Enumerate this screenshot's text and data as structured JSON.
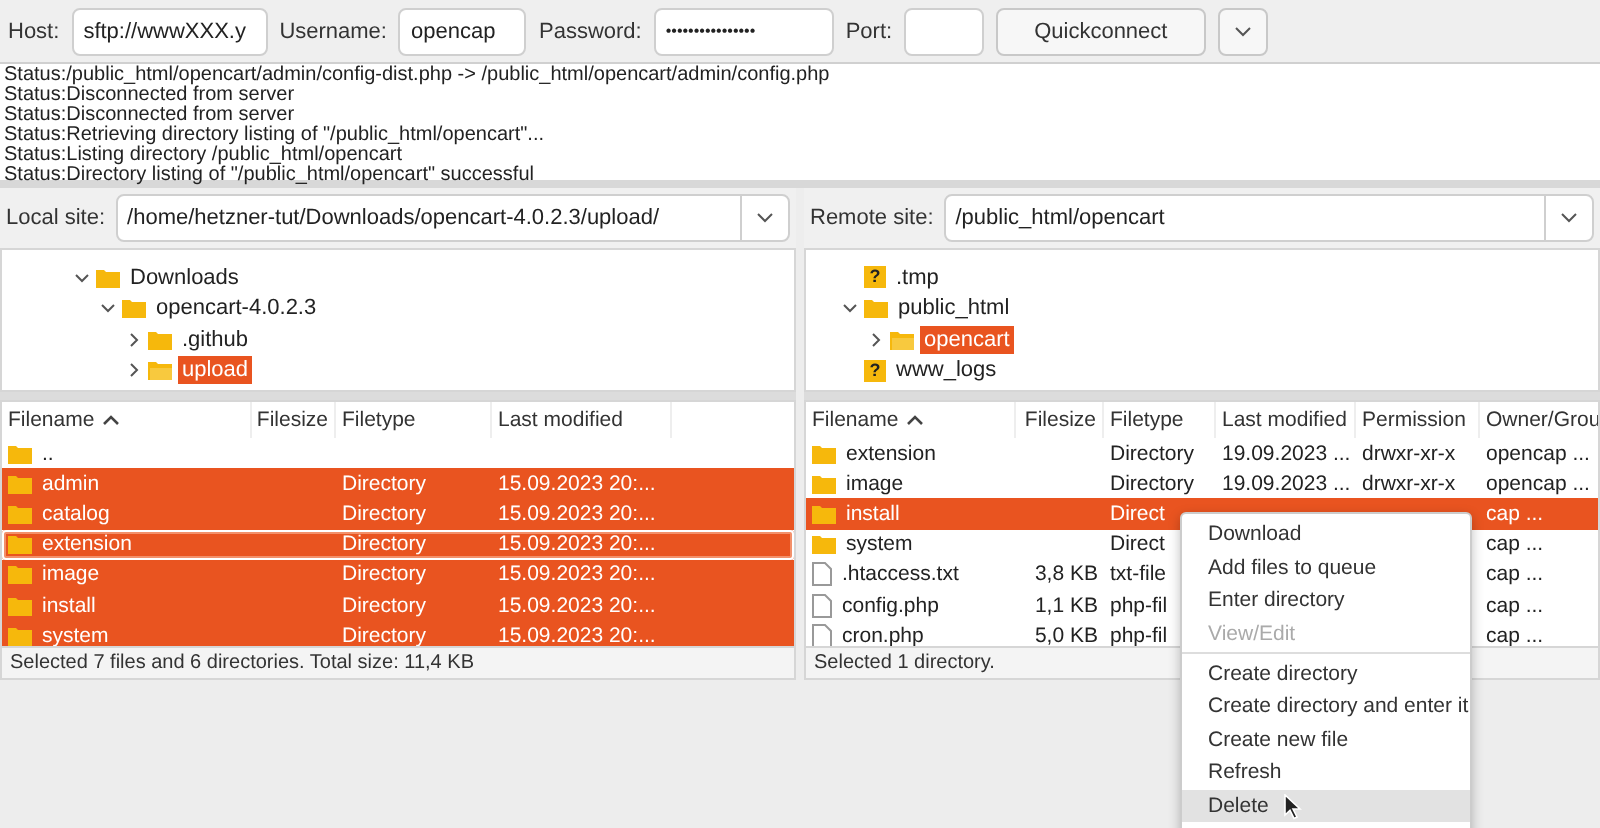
{
  "quickconnect": {
    "host_label": "Host:",
    "host": "sftp://wwwXXX.y",
    "username_label": "Username:",
    "username": "opencap",
    "password_label": "Password:",
    "password": "••••••••••••••••",
    "port_label": "Port:",
    "connect_button": "Quickconnect"
  },
  "log": [
    "Status:/public_html/opencart/admin/config-dist.php -> /public_html/opencart/admin/config.php",
    "Status:Disconnected from server",
    "Status:Disconnected from server",
    "Status:Retrieving directory listing of \"/public_html/opencart\"...",
    "Status:Listing directory /public_html/opencart",
    "Status:Directory listing of \"/public_html/opencart\" successful"
  ],
  "local": {
    "site_label": "Local site:",
    "path": "/home/hetzner-tut/Downloads/opencart-4.0.2.3/upload/",
    "tree": [
      {
        "label": "Downloads",
        "kind": "folder",
        "expanded": true,
        "selected": false,
        "children": [
          {
            "label": "opencart-4.0.2.3",
            "kind": "folder",
            "expanded": true,
            "selected": false,
            "children": [
              {
                "label": ".github",
                "kind": "folder",
                "expanded": false,
                "selected": false
              },
              {
                "label": "upload",
                "kind": "folder",
                "expanded": false,
                "selected": true
              }
            ]
          }
        ]
      }
    ],
    "columns": [
      "Filename",
      "Filesize",
      "Filetype",
      "Last modified"
    ],
    "rows": [
      {
        "name": "..",
        "kind": "folder",
        "size": "",
        "type": "",
        "modified": "",
        "selected": false,
        "focused": false
      },
      {
        "name": "admin",
        "kind": "folder",
        "size": "",
        "type": "Directory",
        "modified": "15.09.2023 20:...",
        "selected": true,
        "focused": false
      },
      {
        "name": "catalog",
        "kind": "folder",
        "size": "",
        "type": "Directory",
        "modified": "15.09.2023 20:...",
        "selected": true,
        "focused": false
      },
      {
        "name": "extension",
        "kind": "folder",
        "size": "",
        "type": "Directory",
        "modified": "15.09.2023 20:...",
        "selected": true,
        "focused": true
      },
      {
        "name": "image",
        "kind": "folder",
        "size": "",
        "type": "Directory",
        "modified": "15.09.2023 20:...",
        "selected": true,
        "focused": false
      },
      {
        "name": "install",
        "kind": "folder",
        "size": "",
        "type": "Directory",
        "modified": "15.09.2023 20:...",
        "selected": true,
        "focused": false
      },
      {
        "name": "system",
        "kind": "folder",
        "size": "",
        "type": "Directory",
        "modified": "15.09.2023 20:...",
        "selected": true,
        "focused": false
      }
    ],
    "status": "Selected 7 files and 6 directories. Total size: 11,4 KB"
  },
  "remote": {
    "site_label": "Remote site:",
    "path": "/public_html/opencart",
    "tree": [
      {
        "label": ".tmp",
        "kind": "unknown",
        "icon": "?",
        "selected": false
      },
      {
        "label": "public_html",
        "kind": "folder",
        "expanded": true,
        "selected": false,
        "children": [
          {
            "label": "opencart",
            "kind": "folder",
            "expanded": false,
            "selected": true
          }
        ]
      },
      {
        "label": "www_logs",
        "kind": "unknown",
        "icon": "?",
        "selected": false
      }
    ],
    "columns": [
      "Filename",
      "Filesize",
      "Filetype",
      "Last modified",
      "Permission",
      "Owner/Grou"
    ],
    "rows": [
      {
        "name": "extension",
        "kind": "folder",
        "size": "",
        "type": "Directory",
        "modified": "19.09.2023 ...",
        "permission": "drwxr-xr-x",
        "owner": "opencap ...",
        "selected": false
      },
      {
        "name": "image",
        "kind": "folder",
        "size": "",
        "type": "Directory",
        "modified": "19.09.2023 ...",
        "permission": "drwxr-xr-x",
        "owner": "opencap ...",
        "selected": false
      },
      {
        "name": "install",
        "kind": "folder",
        "size": "",
        "type": "Direct",
        "modified": "",
        "permission": "",
        "owner": "cap ...",
        "selected": true
      },
      {
        "name": "system",
        "kind": "folder",
        "size": "",
        "type": "Direct",
        "modified": "",
        "permission": "",
        "owner": "cap ...",
        "selected": false
      },
      {
        "name": ".htaccess.txt",
        "kind": "file",
        "size": "3,8 KB",
        "type": "txt-file",
        "modified": "",
        "permission": "",
        "owner": "cap ...",
        "selected": false
      },
      {
        "name": "config.php",
        "kind": "file",
        "size": "1,1 KB",
        "type": "php-fil",
        "modified": "",
        "permission": "",
        "owner": "cap ...",
        "selected": false
      },
      {
        "name": "cron.php",
        "kind": "file",
        "size": "5,0 KB",
        "type": "php-fil",
        "modified": "",
        "permission": "",
        "owner": "cap ...",
        "selected": false
      }
    ],
    "status": "Selected 1 directory."
  },
  "context_menu": [
    {
      "kind": "item",
      "label": "Download",
      "disabled": false,
      "hovered": false
    },
    {
      "kind": "item",
      "label": "Add files to queue",
      "disabled": false,
      "hovered": false
    },
    {
      "kind": "item",
      "label": "Enter directory",
      "disabled": false,
      "hovered": false
    },
    {
      "kind": "item",
      "label": "View/Edit",
      "disabled": true,
      "hovered": false
    },
    {
      "kind": "separator"
    },
    {
      "kind": "item",
      "label": "Create directory",
      "disabled": false,
      "hovered": false
    },
    {
      "kind": "item",
      "label": "Create directory and enter it",
      "disabled": false,
      "hovered": false
    },
    {
      "kind": "item",
      "label": "Create new file",
      "disabled": false,
      "hovered": false
    },
    {
      "kind": "item",
      "label": "Refresh",
      "disabled": false,
      "hovered": false
    },
    {
      "kind": "item",
      "label": "Delete",
      "disabled": false,
      "hovered": true
    }
  ]
}
